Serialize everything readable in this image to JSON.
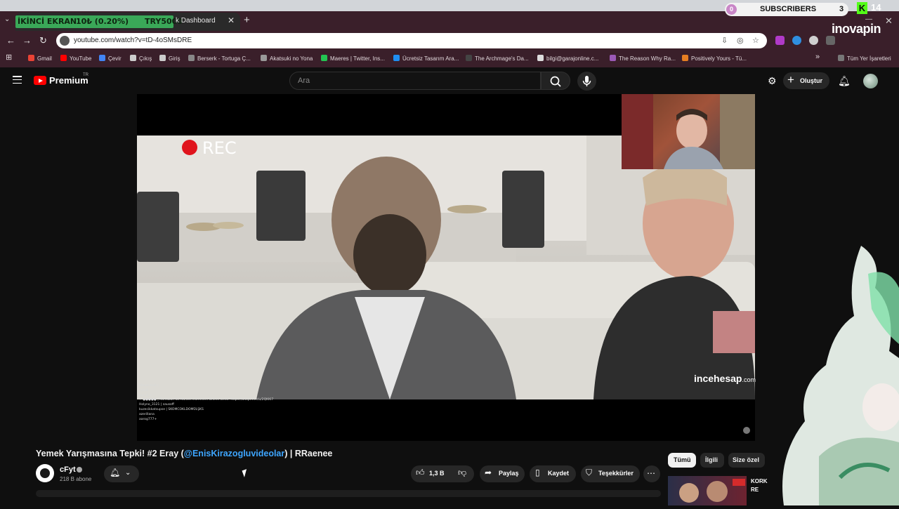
{
  "browser": {
    "overlay": {
      "label": "İKİNCİ EKRAN",
      "stat": "10₺ (0.20%)",
      "goal": "TRY5000"
    },
    "tab_title": "k Dashboard",
    "stream_widget": {
      "subscribers_label": "SUBSCRIBERS",
      "subscribers_count": "3",
      "kick_count": "14",
      "sponsor": "inovapin"
    },
    "url": "youtube.com/watch?v=tD-4oSMsDRE",
    "bookmarks": [
      {
        "label": "Gmail",
        "color": "#ea4335"
      },
      {
        "label": "YouTube",
        "color": "#ff0000"
      },
      {
        "label": "Çevir",
        "color": "#4285f4"
      },
      {
        "label": "Çıkış",
        "color": "#cccccc"
      },
      {
        "label": "Giriş",
        "color": "#cccccc"
      },
      {
        "label": "Berserk - Tortuga Ç...",
        "color": "#888888"
      },
      {
        "label": "Akatsuki no Yona",
        "color": "#999999"
      },
      {
        "label": "Maeres | Twitter, Ins...",
        "color": "#23c552"
      },
      {
        "label": "Ücretsiz Tasarım Ara...",
        "color": "#1f8ef1"
      },
      {
        "label": "The Archmage's Da...",
        "color": "#444444"
      },
      {
        "label": "bilgi@garajonline.c...",
        "color": "#dddddd"
      },
      {
        "label": "The Reason Why Ra...",
        "color": "#9b59b6"
      },
      {
        "label": "Positively Yours - Tü...",
        "color": "#e67e22"
      }
    ],
    "all_bookmarks_label": "Tüm Yer İşaretleri"
  },
  "youtube": {
    "logo_label": "Premium",
    "region": "TR",
    "search_placeholder": "Ara",
    "create_label": "Oluştur",
    "video": {
      "rec_label": "REC",
      "watermark_main": "incehesap",
      "watermark_suffix": ".com",
      "chat_lines": [
        "Pinasomnit |",
        "cyanli",
        "yusuk+",
        "✦ ●●●●● | Ramazan'da Market İndirimleri Online Geldi! https://adopt.live/u/2QKKI7",
        "Holyno_3121 | sausoff",
        "kuzecikkatsupse | SKOMCOKLDOMÜLŞKS",
        "azerillana",
        "aarog777+"
      ]
    },
    "title_prefix": "Yemek Yarışmasına Tepki! #2 Eray (",
    "title_link": "@EnisKirazogluvideolar",
    "title_suffix": ") | RRaenee",
    "channel_name": "cFyt",
    "channel_subs": "218 B abone",
    "like_count": "1,3 B",
    "share_label": "Paylaş",
    "save_label": "Kaydet",
    "thanks_label": "Teşekkürler",
    "chips": [
      "Tümü",
      "İlgili",
      "Size özel"
    ],
    "recommendation_title": "KORK\nRE"
  }
}
